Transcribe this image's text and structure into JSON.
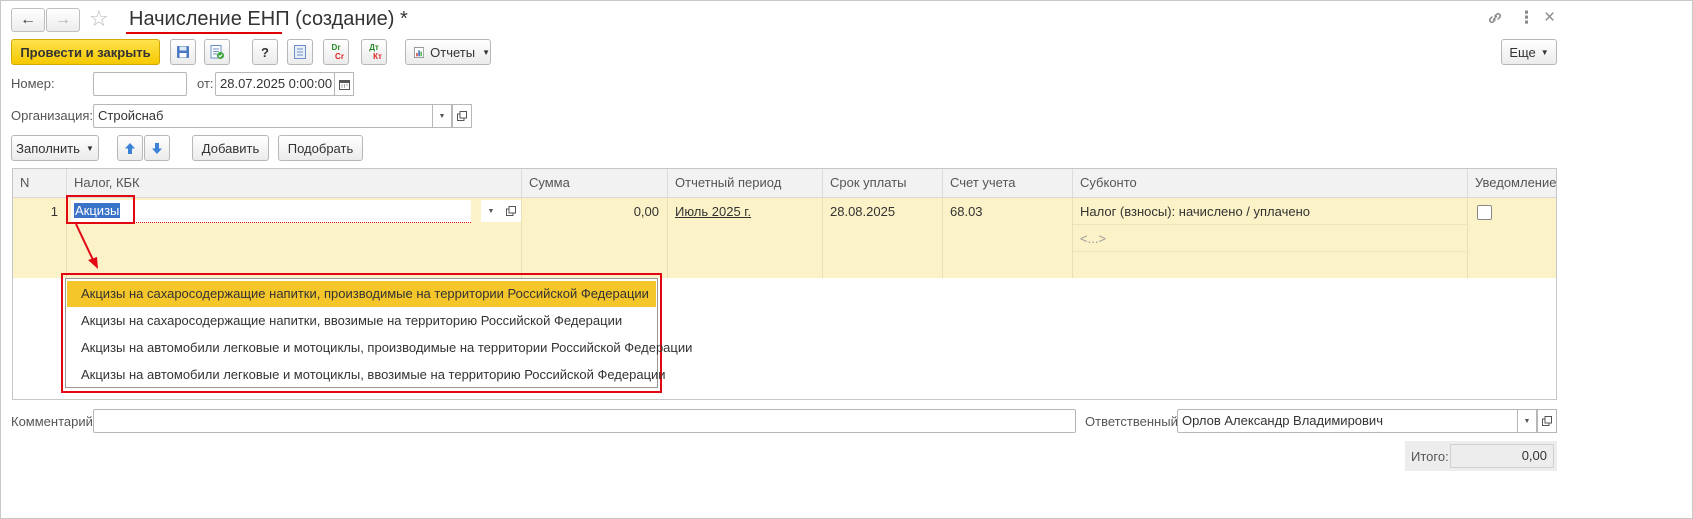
{
  "window": {
    "title": "Начисление ЕНП (создание) *",
    "nav_back": "←",
    "nav_forward": "→",
    "star": "☆",
    "link_icon": "link-icon",
    "more_icon": "⋮",
    "close_icon": "×"
  },
  "toolbar": {
    "post_close": "Провести и закрыть",
    "help": "?",
    "dt_top": "Dr",
    "dt_bottom": "Cr",
    "kt_top": "Дт",
    "kt_bottom": "Кт",
    "reports": "Отчеты",
    "more": "Еще"
  },
  "header": {
    "number_label": "Номер:",
    "number_value": "",
    "date_label": "от:",
    "date_value": "28.07.2025  0:00:00",
    "org_label": "Организация:",
    "org_value": "Стройснаб"
  },
  "table_toolbar": {
    "fill": "Заполнить",
    "add": "Добавить",
    "pick": "Подобрать"
  },
  "table": {
    "columns": [
      "N",
      "Налог, КБК",
      "Сумма",
      "Отчетный период",
      "Срок уплаты",
      "Счет учета",
      "Субконто",
      "Уведомление"
    ],
    "row": {
      "n": "1",
      "tax": "Акцизы",
      "sum": "0,00",
      "period": "Июль 2025 г.",
      "due": "28.08.2025",
      "account": "68.03",
      "subconto1": "Налог (взносы): начислено / уплачено",
      "subconto2": "<...>",
      "notice": false
    }
  },
  "dropdown": {
    "items": [
      "Акцизы на сахаросодержащие напитки, производимые на территории Российской Федерации",
      "Акцизы на сахаросодержащие напитки, ввозимые на территорию Российской Федерации",
      "Акцизы на автомобили легковые и мотоциклы, производимые на территории Российской Федерации",
      "Акцизы на автомобили легковые и мотоциклы, ввозимые на территорию Российской Федерации"
    ],
    "selected_index": 0
  },
  "footer": {
    "comment_label": "Комментарий:",
    "comment_value": "",
    "responsible_label": "Ответственный:",
    "responsible_value": "Орлов Александр Владимирович",
    "total_label": "Итого:",
    "total_value": "0,00"
  },
  "colors": {
    "accent": "#f5c800",
    "highlight": "#e30613",
    "row_bg": "#fcf2c8"
  }
}
